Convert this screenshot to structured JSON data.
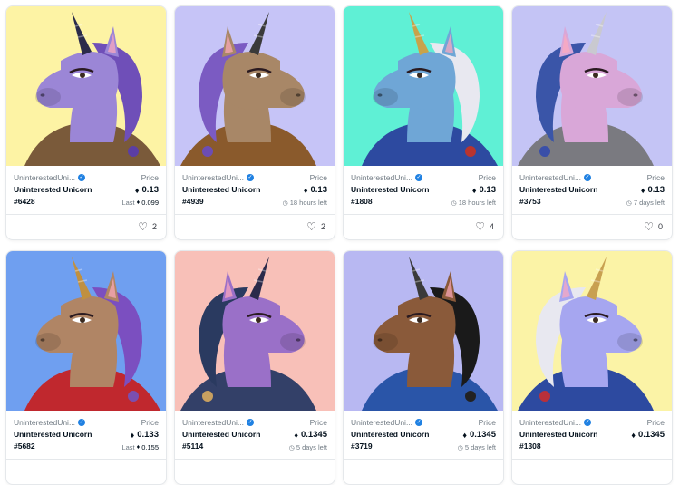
{
  "cards": [
    {
      "collection": "UninterestedUni...",
      "name": "Uninterested Unicorn",
      "token": "#6428",
      "price_label": "Price",
      "price": "0.13",
      "sub_label": "Last",
      "sub_value": "0.099",
      "sub_type": "last",
      "likes": "2",
      "bg": "#fdf3a4",
      "accent": "#5b3ea5",
      "skin": "#9b86d6",
      "mane": "#6f4fb8",
      "horn": "#2b2b4a",
      "outfit": "#7a5a3a"
    },
    {
      "collection": "UninterestedUni...",
      "name": "Uninterested Unicorn",
      "token": "#4939",
      "price_label": "Price",
      "price": "0.13",
      "sub_label": "18 hours left",
      "sub_value": "",
      "sub_type": "time",
      "likes": "2",
      "bg": "#c6c4f7",
      "accent": "#6c4db4",
      "skin": "#a88767",
      "mane": "#7b5bc2",
      "horn": "#3a3a3a",
      "outfit": "#8a5a2c"
    },
    {
      "collection": "UninterestedUni...",
      "name": "Uninterested Unicorn",
      "token": "#1808",
      "price_label": "Price",
      "price": "0.13",
      "sub_label": "18 hours left",
      "sub_value": "",
      "sub_type": "time",
      "likes": "4",
      "bg": "#5ff0d5",
      "accent": "#b8342e",
      "skin": "#6fa6d6",
      "mane": "#e8e8f0",
      "horn": "#c8a34a",
      "outfit": "#2d4aa0"
    },
    {
      "collection": "UninterestedUni...",
      "name": "Uninterested Unicorn",
      "token": "#3753",
      "price_label": "Price",
      "price": "0.13",
      "sub_label": "7 days left",
      "sub_value": "",
      "sub_type": "time",
      "likes": "0",
      "bg": "#c4c4f5",
      "accent": "#3a4fa8",
      "skin": "#d9a7d8",
      "mane": "#3a55a8",
      "horn": "#c9c9d0",
      "outfit": "#7a7a80"
    },
    {
      "collection": "UninterestedUni...",
      "name": "Uninterested Unicorn",
      "token": "#5682",
      "price_label": "Price",
      "price": "0.133",
      "sub_label": "Last",
      "sub_value": "0.155",
      "sub_type": "last",
      "likes": "",
      "bg": "#6f9ff0",
      "accent": "#7a4fb0",
      "skin": "#b08565",
      "mane": "#7b4fc0",
      "horn": "#c09040",
      "outfit": "#c0282e"
    },
    {
      "collection": "UninterestedUni...",
      "name": "Uninterested Unicorn",
      "token": "#5114",
      "price_label": "Price",
      "price": "0.1345",
      "sub_label": "5 days left",
      "sub_value": "",
      "sub_type": "time",
      "likes": "",
      "bg": "#f8c0b8",
      "accent": "#c8a060",
      "skin": "#9a70c8",
      "mane": "#2a3a60",
      "horn": "#2a2a4a",
      "outfit": "#334068"
    },
    {
      "collection": "UninterestedUni...",
      "name": "Uninterested Unicorn",
      "token": "#3719",
      "price_label": "Price",
      "price": "0.1345",
      "sub_label": "5 days left",
      "sub_value": "",
      "sub_type": "time",
      "likes": "",
      "bg": "#b8b8f2",
      "accent": "#222222",
      "skin": "#8a5a3a",
      "mane": "#1a1a1a",
      "horn": "#3a3a3a",
      "outfit": "#2a55a8"
    },
    {
      "collection": "UninterestedUni...",
      "name": "Uninterested Unicorn",
      "token": "#1308",
      "price_label": "Price",
      "price": "0.1345",
      "sub_label": "",
      "sub_value": "",
      "sub_type": "none",
      "likes": "",
      "bg": "#fbf3a6",
      "accent": "#b8303a",
      "skin": "#a6a6f0",
      "mane": "#e8e8f0",
      "horn": "#c8a050",
      "outfit": "#2d4aa0"
    }
  ]
}
